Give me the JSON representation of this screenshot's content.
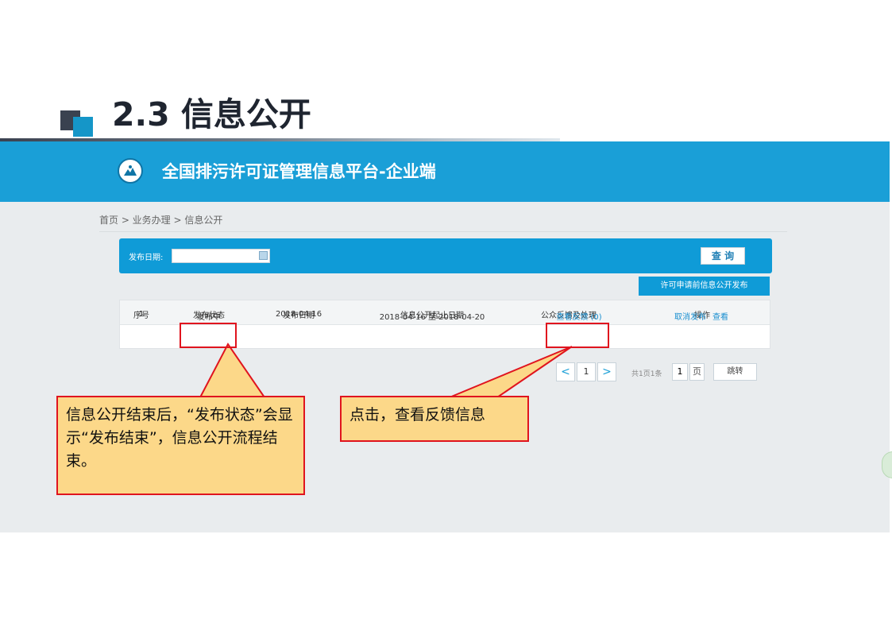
{
  "slide": {
    "title": "2.3  信息公开"
  },
  "app": {
    "title": "全国排污许可证管理信息平台-企业端",
    "logo_icon": "mes-emblem-icon"
  },
  "breadcrumb": "首页 > 业务办理 > 信息公开",
  "search": {
    "date_label": "发布日期:",
    "date_value": "",
    "query_label": "查 询"
  },
  "publish_button": "许可申请前信息公开发布",
  "table": {
    "headers": [
      "序号",
      "发布状态",
      "发布日期",
      "信息公开起止日期",
      "公众反馈及处理",
      "操作"
    ],
    "rows": [
      {
        "no": "1",
        "status": "发布中",
        "date": "2018-04-16",
        "period": "2018-04-16 至 2018-04-20",
        "feedback": "查看反馈  (0)",
        "cancel": "取消发布",
        "view": "查看"
      }
    ]
  },
  "pagination": {
    "prev": "<",
    "current": "1",
    "next": ">",
    "total": "共1页1条",
    "page_value": "1",
    "page_unit": "页",
    "jump": "跳转"
  },
  "annotations": {
    "status_note": "信息公开结束后，“发布状态”会显示“发布结束”，信息公开流程结束。",
    "feedback_note": "点击，查看反馈信息"
  },
  "colors": {
    "banner": "#1a9fd7",
    "accent_red": "#e0141e",
    "callout_fill": "#fcd889"
  }
}
